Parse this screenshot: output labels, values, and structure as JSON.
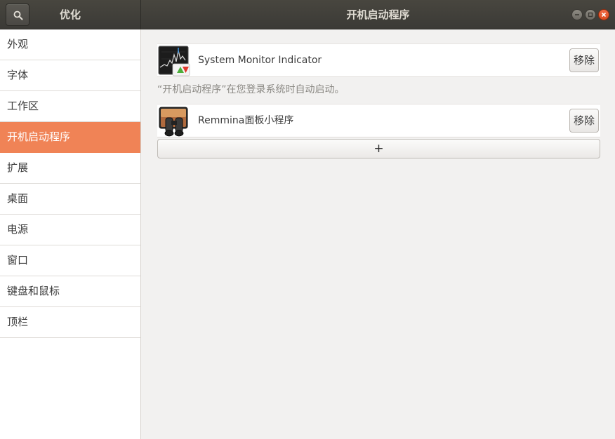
{
  "header": {
    "app_title": "优化",
    "page_title": "开机启动程序",
    "search_icon": "search-icon",
    "window_buttons": [
      "minimize",
      "maximize",
      "close"
    ]
  },
  "sidebar": {
    "items": [
      {
        "label": "外观",
        "active": false
      },
      {
        "label": "字体",
        "active": false
      },
      {
        "label": "工作区",
        "active": false
      },
      {
        "label": "开机启动程序",
        "active": true
      },
      {
        "label": "扩展",
        "active": false
      },
      {
        "label": "桌面",
        "active": false
      },
      {
        "label": "电源",
        "active": false
      },
      {
        "label": "窗口",
        "active": false
      },
      {
        "label": "键盘和鼠标",
        "active": false
      },
      {
        "label": "顶栏",
        "active": false
      }
    ]
  },
  "main": {
    "startup_apps": [
      {
        "name": "System Monitor Indicator",
        "icon": "system-monitor-icon",
        "remove_label": "移除"
      },
      {
        "name": "Remmina面板小程序",
        "icon": "remmina-binoculars-icon",
        "remove_label": "移除"
      }
    ],
    "hint": "“开机启动程序”在您登录系统时自动启动。",
    "add_label": "+"
  },
  "colors": {
    "accent": "#f08356",
    "header_bg": "#3b3a36",
    "close_button": "#e05a2f"
  }
}
